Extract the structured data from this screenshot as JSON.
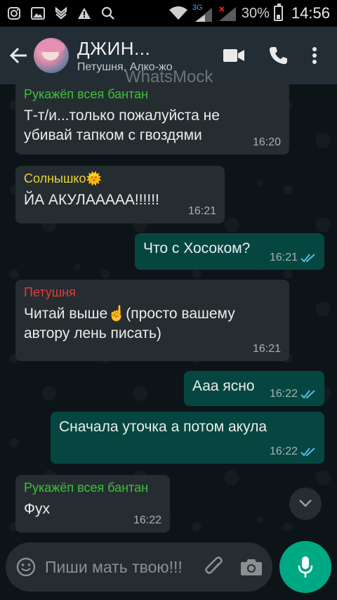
{
  "status_bar": {
    "network_label": "3G",
    "battery": "30%",
    "time": "14:56"
  },
  "header": {
    "title": "ДЖИН...",
    "subtitle": "Петушня, Алко-жо",
    "watermark": "WhatsMock"
  },
  "messages": [
    {
      "direction": "in",
      "sender": "Рукажёп всея бантан",
      "sender_color": "#3cc13c",
      "text": "Т-т/и...только пожалуйста не убивай тапком с гвоздями",
      "time": "16:20"
    },
    {
      "direction": "in",
      "sender": "Солнышко🌞",
      "sender_color": "#e8d13a",
      "text": "ЙА АКУЛААААА!!!!!!",
      "time": "16:21"
    },
    {
      "direction": "out",
      "text": "Что с Хосоком?",
      "time": "16:21",
      "read": true
    },
    {
      "direction": "in",
      "sender": "Петушня",
      "sender_color": "#e23b3b",
      "text": "Читай выше☝️(просто вашему автору лень писать)",
      "time": "16:21"
    },
    {
      "direction": "out",
      "text": "Ааа ясно",
      "time": "16:22",
      "read": true
    },
    {
      "direction": "out",
      "text": "Сначала уточка а потом акула",
      "time": "16:22",
      "read": true
    },
    {
      "direction": "in",
      "sender": "Рукажёп всея бантан",
      "sender_color": "#3cc13c",
      "text": "Фух",
      "time": "16:22"
    }
  ],
  "input": {
    "placeholder": "Пиши мать твою!!!"
  },
  "colors": {
    "header_bg": "#232d36",
    "incoming_bubble": "#262d31",
    "outgoing_bubble": "#054740",
    "accent": "#00a884",
    "read_ticks": "#53bdeb"
  },
  "icons": {
    "back": "arrow-left-icon",
    "video": "video-call-icon",
    "call": "phone-icon",
    "menu": "more-vertical-icon",
    "emoji": "emoji-icon",
    "attach": "paperclip-icon",
    "camera": "camera-icon",
    "mic": "mic-icon",
    "scroll": "chevron-down-icon"
  }
}
